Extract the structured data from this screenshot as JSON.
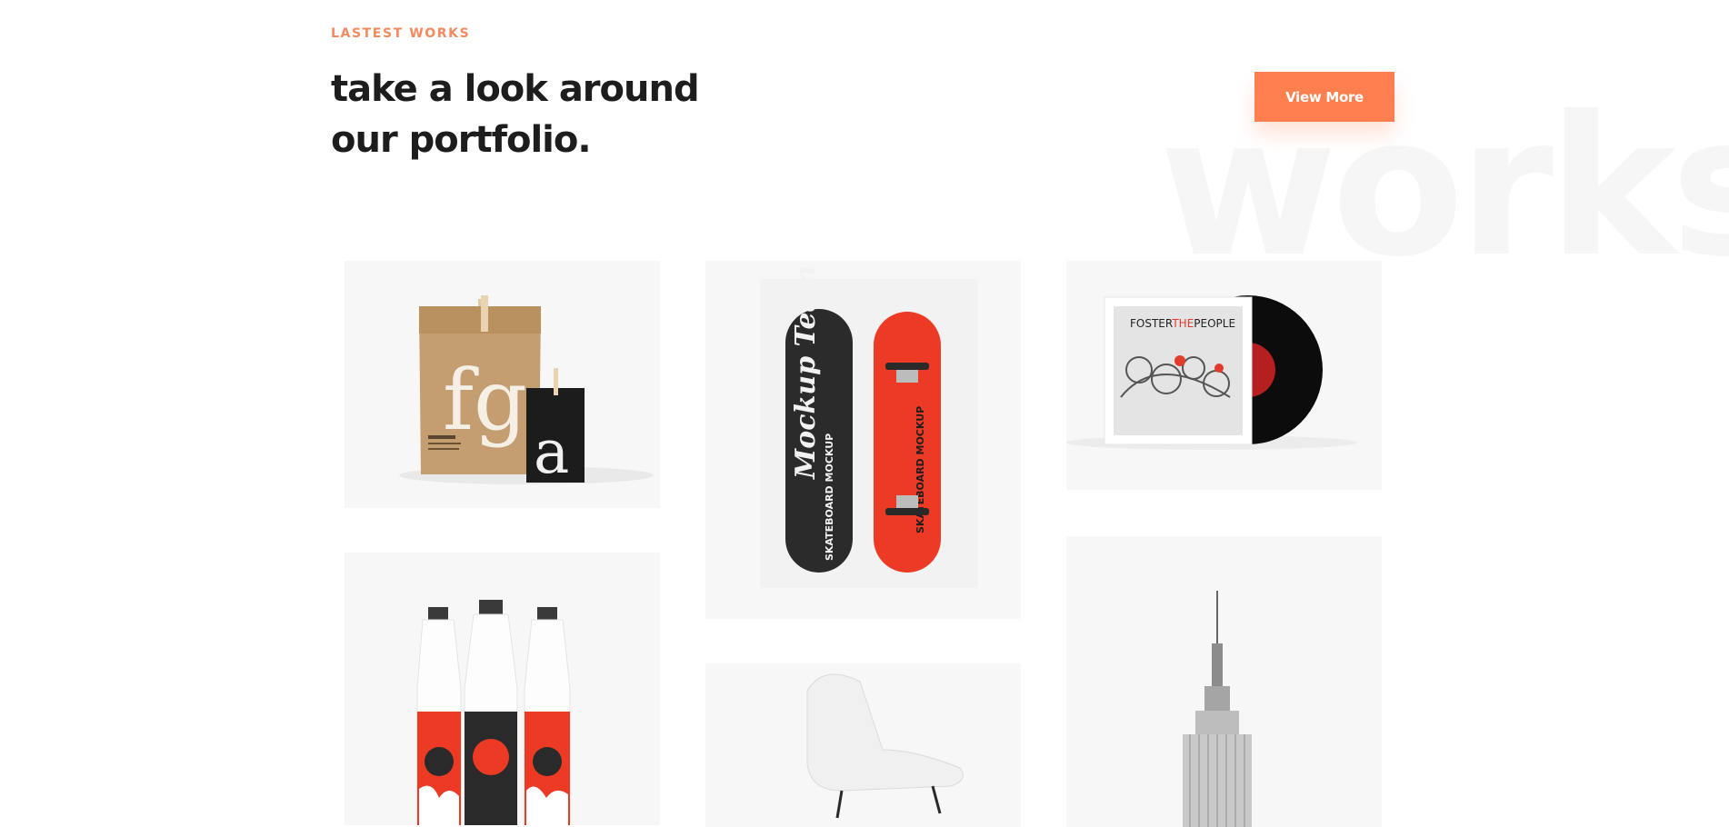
{
  "section": {
    "eyebrow": "LASTEST WORKS",
    "headline_line1": "take a look around",
    "headline_line2": "our portfolio.",
    "button_label": "View More",
    "watermark": "works"
  },
  "colors": {
    "accent": "#fd7f50",
    "heading": "#1d1d1d",
    "card_bg": "#f7f7f7",
    "watermark": "#f6f6f6"
  },
  "portfolio": {
    "items": [
      {
        "name": "paper-bag-branding",
        "letters_bag": "fg",
        "letters_pouch": "a"
      },
      {
        "name": "skateboard-mockup",
        "deck_script": "Mockup Team",
        "deck_text": "SKATEBOARD MOCKUP"
      },
      {
        "name": "vinyl-record-mockup",
        "album_title_a": "FOSTER",
        "album_title_b": "THE",
        "album_title_c": "PEOPLE"
      },
      {
        "name": "milk-bottles-mockup"
      },
      {
        "name": "white-chair-photo"
      },
      {
        "name": "skyscraper-photo"
      }
    ]
  }
}
